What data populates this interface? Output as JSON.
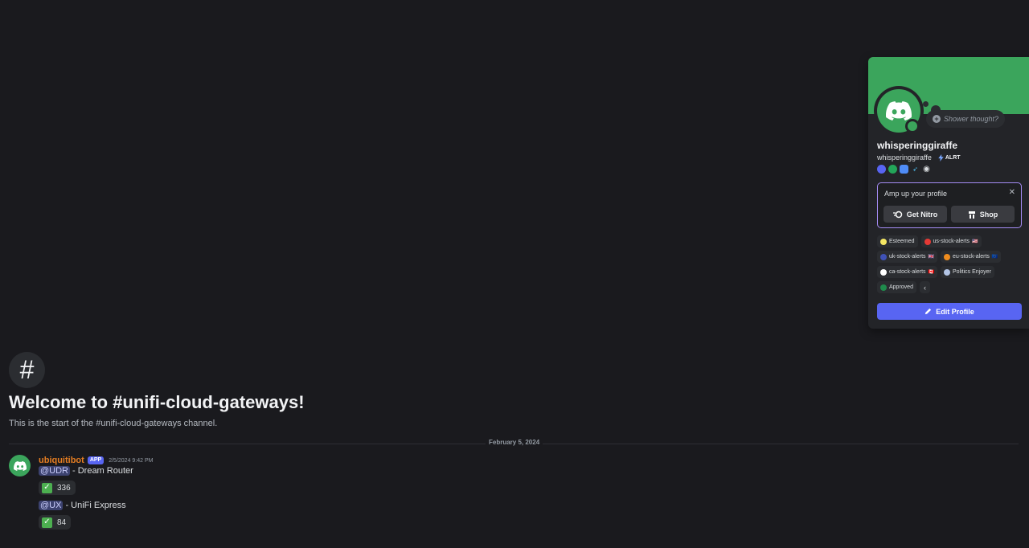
{
  "channel": {
    "hash_glyph": "#",
    "welcome_title": "Welcome to #unifi-cloud-gateways!",
    "welcome_subtitle": "This is the start of the #unifi-cloud-gateways channel.",
    "date_divider": "February 5, 2024"
  },
  "message": {
    "author": "ubiquitibot",
    "app_badge": "APP",
    "timestamp": "2/5/2024 9:42 PM",
    "author_color": "#e67e22",
    "lines": [
      {
        "mention": "@UDR",
        "text": "- Dream Router",
        "reaction_emoji": "✓",
        "reaction_count": "336"
      },
      {
        "mention": "@UX",
        "text": "- UniFi Express",
        "reaction_emoji": "✓",
        "reaction_count": "84"
      }
    ]
  },
  "profile": {
    "banner_color": "#3ba55c",
    "thought_placeholder": "Shower thought?",
    "display_name": "whisperinggiraffe",
    "username": "whisperinggiraffe",
    "tag": "ALRT",
    "badges": [
      {
        "icon": "hypesquad-icon",
        "color": "#5865f2"
      },
      {
        "icon": "nitro-icon",
        "color": "#23a559"
      },
      {
        "icon": "monitor-icon",
        "color": "#4f8cf7"
      },
      {
        "icon": "quest-icon",
        "color": "#4fc3f7"
      },
      {
        "icon": "gamepad-icon",
        "color": "#dbdee1"
      }
    ],
    "amp": {
      "title": "Amp up your profile",
      "nitro_label": "Get Nitro",
      "shop_label": "Shop"
    },
    "roles": [
      {
        "name": "Esteemed",
        "color": "#f5e663",
        "flag": ""
      },
      {
        "name": "us-stock-alerts",
        "color": "#e53935",
        "flag": "🇺🇸"
      },
      {
        "name": "uk-stock-alerts",
        "color": "#3f51b5",
        "flag": "🇬🇧"
      },
      {
        "name": "eu-stock-alerts",
        "color": "#ef8c1e",
        "flag": "🇪🇺"
      },
      {
        "name": "ca-stock-alerts",
        "color": "#ffffff",
        "flag": "🇨🇦"
      },
      {
        "name": "Politics Enjoyer",
        "color": "#b3c5e6",
        "flag": ""
      },
      {
        "name": "Approved",
        "color": "#1f8b4c",
        "flag": ""
      }
    ],
    "edit_label": "Edit Profile"
  }
}
